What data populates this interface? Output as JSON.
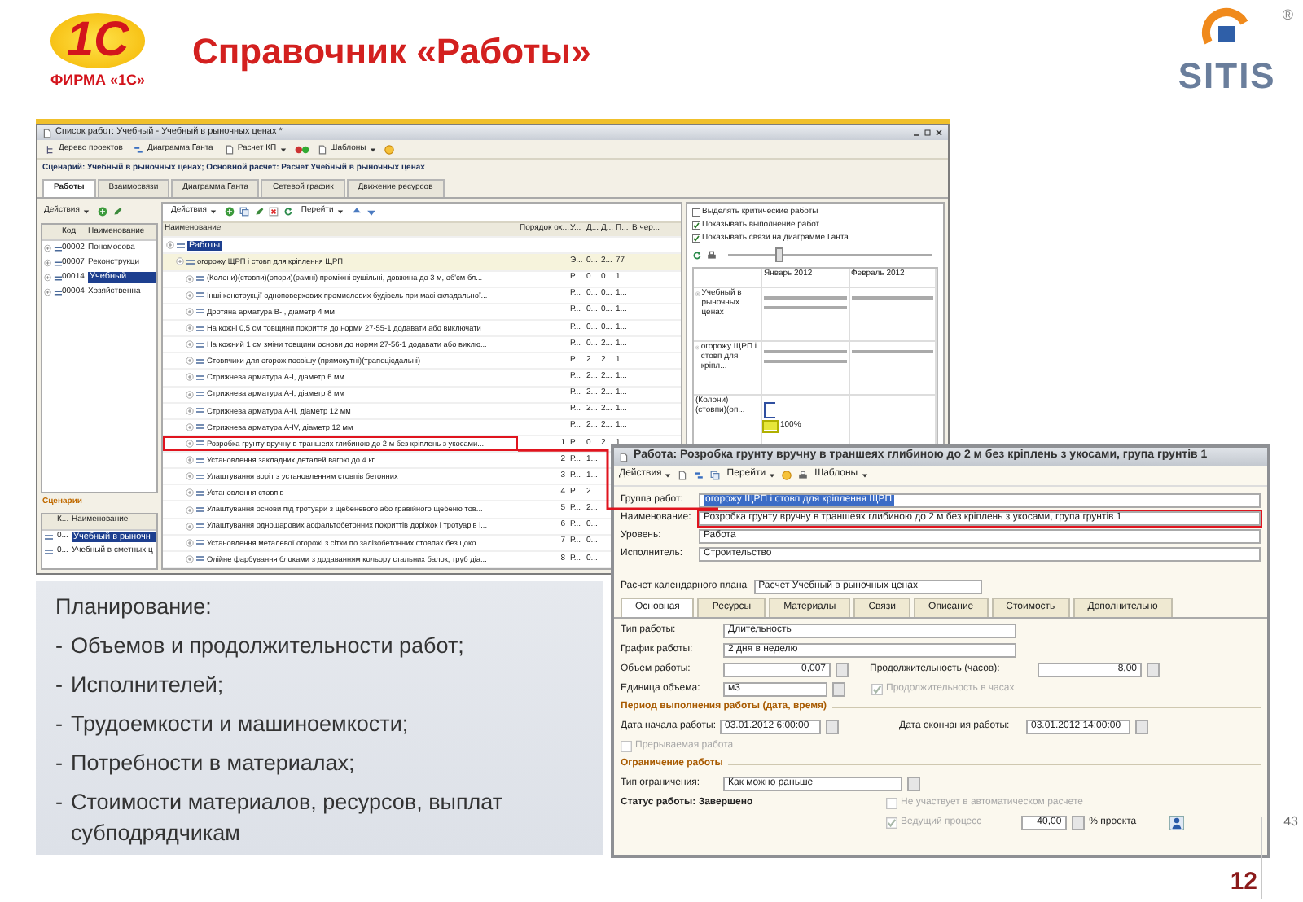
{
  "header": {
    "logo": {
      "mark": "1С",
      "caption": "ФИРМА «1С»"
    },
    "title": "Справочник «Работы»",
    "partner_logo": {
      "text": "SITIS",
      "registered": "®"
    }
  },
  "list_window": {
    "title": "Список работ: Учебный - Учебный в рыночных ценах *",
    "toolbar": [
      {
        "label": "Дерево проектов",
        "dropdown": false
      },
      {
        "label": "Диаграмма Ганта",
        "dropdown": false
      },
      {
        "label": "Расчет КП",
        "dropdown": true
      },
      {
        "label": "Шаблоны",
        "dropdown": true
      }
    ],
    "scenario": "Сценарий: Учебный в рыночных ценах; Основной расчет: Расчет Учебный в рыночных ценах",
    "tabs": [
      {
        "label": "Работы",
        "selected": true
      },
      {
        "label": "Взаимосвязи",
        "selected": false
      },
      {
        "label": "Диаграмма Ганта",
        "selected": false
      },
      {
        "label": "Сетевой график",
        "selected": false
      },
      {
        "label": "Движение ресурсов",
        "selected": false
      }
    ],
    "projects": {
      "actions": "Действия",
      "columns": [
        "Код",
        "Наименование"
      ],
      "rows": [
        {
          "code": "00002",
          "name": "Пономосова",
          "selected": false
        },
        {
          "code": "00007",
          "name": "Реконструкци",
          "selected": false
        },
        {
          "code": "00014",
          "name": "Учебный",
          "selected": true
        },
        {
          "code": "00004",
          "name": "Хозяйственна",
          "selected": false
        }
      ]
    },
    "scenarios": {
      "title": "Сценарии",
      "columns": [
        "К...",
        "Наименование"
      ],
      "rows": [
        {
          "code": "0...",
          "name": "Учебный в рыночн",
          "selected": true
        },
        {
          "code": "0...",
          "name": "Учебный в сметных ц",
          "selected": false
        }
      ]
    },
    "works": {
      "actions": "Действия",
      "goto": "Перейти",
      "columns": [
        "Наименование",
        "Порядок ох...",
        "У...",
        "Д...",
        "Д...",
        "П...",
        "В чер..."
      ],
      "rows": [
        {
          "name": "Работы",
          "selected": true,
          "children": [
            {
              "name": "огорожу ЩРП і стовп для кріплення ЩРП",
              "selected": false,
              "cells": [
                "Э...",
                "0...",
                "2...",
                "77"
              ],
              "children": [
                {
                  "name": "(Колони)(стовпи)(опори)(рамні) проміжні сущільні, довжина до 3 м, об'єм бл...",
                  "highlighted": false,
                  "cells": [
                    "Р...",
                    "0...",
                    "0...",
                    "1..."
                  ]
                },
                {
                  "name": "Інші конструкції одноповерхових промислових будівель при масі складальної...",
                  "highlighted": false,
                  "cells": [
                    "Р...",
                    "0...",
                    "0...",
                    "1..."
                  ]
                },
                {
                  "name": "Дротяна арматура В-І, діаметр 4 мм",
                  "highlighted": false,
                  "cells": [
                    "Р...",
                    "0...",
                    "0...",
                    "1..."
                  ]
                },
                {
                  "name": "На кожні 0,5 см товщини покриття до норми 27-55-1 додавати або виключати",
                  "highlighted": false,
                  "cells": [
                    "Р...",
                    "0...",
                    "0...",
                    "1..."
                  ]
                },
                {
                  "name": "На кожний 1 см зміни товщини основи до норми 27-56-1 додавати або виклю...",
                  "highlighted": false,
                  "cells": [
                    "Р...",
                    "0...",
                    "2...",
                    "1..."
                  ]
                },
                {
                  "name": "Стовпчики для огорож посвішу (прямокутні)(трапецієдальні)",
                  "highlighted": false,
                  "cells": [
                    "Р...",
                    "2...",
                    "2...",
                    "1..."
                  ]
                },
                {
                  "name": "Стрижнева арматура А-І, діаметр 6 мм",
                  "highlighted": false,
                  "cells": [
                    "Р...",
                    "2...",
                    "2...",
                    "1..."
                  ]
                },
                {
                  "name": "Стрижнева арматура А-І, діаметр 8 мм",
                  "highlighted": false,
                  "cells": [
                    "Р...",
                    "2...",
                    "2...",
                    "1..."
                  ]
                },
                {
                  "name": "Стрижнева арматура А-ІІ, діаметр 12 мм",
                  "highlighted": false,
                  "cells": [
                    "Р...",
                    "2...",
                    "2...",
                    "1..."
                  ]
                },
                {
                  "name": "Стрижнева арматура А-ІV, діаметр 12 мм",
                  "highlighted": false,
                  "cells": [
                    "Р...",
                    "2...",
                    "2...",
                    "1..."
                  ]
                },
                {
                  "name": "Розробка грунту вручну в траншеях глибиною до 2 м без кріплень з укосами...",
                  "highlighted": true,
                  "order": "1",
                  "cells": [
                    "Р...",
                    "0...",
                    "2...",
                    "1..."
                  ]
                },
                {
                  "name": "Установлення закладних деталей вагою до 4 кг",
                  "highlighted": false,
                  "order": "2",
                  "cells": [
                    "Р...",
                    "1..."
                  ]
                },
                {
                  "name": "Улаштування воріт з установленням стовпів бетонних",
                  "highlighted": false,
                  "order": "3",
                  "cells": [
                    "Р...",
                    "1..."
                  ]
                },
                {
                  "name": "Установлення стовпів",
                  "highlighted": false,
                  "order": "4",
                  "cells": [
                    "Р...",
                    "2..."
                  ]
                },
                {
                  "name": "Улаштування основи під тротуари з щебеневого або гравійного щебеню тов...",
                  "highlighted": false,
                  "order": "5",
                  "cells": [
                    "Р...",
                    "2..."
                  ]
                },
                {
                  "name": "Улаштування одношарових асфальтобетонних покриттів доріжок і тротуарів і...",
                  "highlighted": false,
                  "order": "6",
                  "cells": [
                    "Р...",
                    "0..."
                  ]
                },
                {
                  "name": "Установлення металевої огорожі з сітки по залізобетонних стовпах без цоко...",
                  "highlighted": false,
                  "order": "7",
                  "cells": [
                    "Р...",
                    "0..."
                  ]
                },
                {
                  "name": "Олійне фарбування блоками з додаванням кольору стальних балок, труб діа...",
                  "highlighted": false,
                  "order": "8",
                  "cells": [
                    "Р...",
                    "0..."
                  ]
                }
              ]
            }
          ]
        }
      ]
    },
    "gantt": {
      "options": [
        {
          "label": "Выделять критические работы",
          "checked": false
        },
        {
          "label": "Показывать выполнение работ",
          "checked": true
        },
        {
          "label": "Показывать связи на диаграмме Ганта",
          "checked": true
        }
      ],
      "scale": {
        "level": 0.25
      },
      "months": [
        "Январь 2012",
        "Февраль 2012"
      ],
      "rows": [
        {
          "name": "Учебный в рыночных ценах",
          "kind": "summary"
        },
        {
          "name": "огорожу ЩРП і стовп для кріпл...",
          "kind": "summary"
        },
        {
          "name": "(Колони)(стовпи)(оп...",
          "kind": "task",
          "progress": "100%",
          "level": 1
        }
      ]
    }
  },
  "plan": {
    "heading": "Планирование:",
    "marker": "-",
    "items": [
      "Объемов и продолжительности работ;",
      "Исполнителей;",
      "Трудоемкости и машиноемкости;",
      "Потребности в материалах;",
      "Стоимости материалов, ресурсов, выплат субподрядчикам"
    ]
  },
  "dialog": {
    "title": "Работа: Розробка грунту вручну в траншеях глибиною до 2 м без кріплень з укосами, група грунтів 1",
    "toolbar": {
      "actions": "Действия",
      "goto": "Перейти",
      "templates": "Шаблоны"
    },
    "fields": [
      {
        "label": "Группа работ:",
        "value": "огорожу ЩРП і стовп для кріплення ЩРП",
        "selected": true,
        "highlighted": false
      },
      {
        "label": "Наименование:",
        "value": "Розробка грунту вручну в траншеях глибиною до 2 м без кріплень з укосами, група грунтів 1",
        "selected": false,
        "highlighted": true
      },
      {
        "label": "Уровень:",
        "value": "Работа",
        "selected": false,
        "highlighted": false
      },
      {
        "label": "Исполнитель:",
        "value": "Строительство",
        "selected": false,
        "highlighted": false
      }
    ],
    "calc_plan": {
      "label": "Расчет календарного плана",
      "value": "Расчет Учебный в рыночных ценах"
    },
    "tabs": [
      {
        "label": "Основная",
        "selected": true
      },
      {
        "label": "Ресурсы",
        "selected": false
      },
      {
        "label": "Материалы",
        "selected": false
      },
      {
        "label": "Связи",
        "selected": false
      },
      {
        "label": "Описание",
        "selected": false
      },
      {
        "label": "Стоимость",
        "selected": false
      },
      {
        "label": "Дополнительно",
        "selected": false
      }
    ],
    "main": {
      "work_type": {
        "label": "Тип работы:",
        "value": "Длительность"
      },
      "schedule": {
        "label": "График работы:",
        "value": "2 дня в неделю"
      },
      "volume": {
        "label": "Объем работы:",
        "value": "0,007"
      },
      "duration": {
        "label": "Продолжительность (часов):",
        "value": "8,00"
      },
      "unit": {
        "label": "Единица объема:",
        "value": "м3"
      },
      "hours": {
        "label": "Продолжительность в часах",
        "checked": true,
        "disabled": true
      }
    },
    "period": {
      "title": "Период выполнения работы (дата, время)",
      "start": {
        "label": "Дата начала работы:",
        "value": "03.01.2012 6:00:00"
      },
      "end": {
        "label": "Дата окончания работы:",
        "value": "03.01.2012 14:00:00"
      },
      "interruptible": {
        "label": "Прерываемая работа",
        "checked": false,
        "disabled": true
      }
    },
    "constraint": {
      "title": "Ограничение работы",
      "type": {
        "label": "Тип ограничения:",
        "value": "Как можно раньше"
      }
    },
    "status": "Статус работы: Завершено",
    "auto": {
      "label": "Не участвует в автоматическом расчете",
      "checked": false,
      "disabled": true
    },
    "leading": {
      "label": "Ведущий процесс",
      "checked": true,
      "disabled": true,
      "value": "40,00",
      "unit": "% проекта"
    }
  },
  "page": {
    "number": "12",
    "total": "43"
  }
}
